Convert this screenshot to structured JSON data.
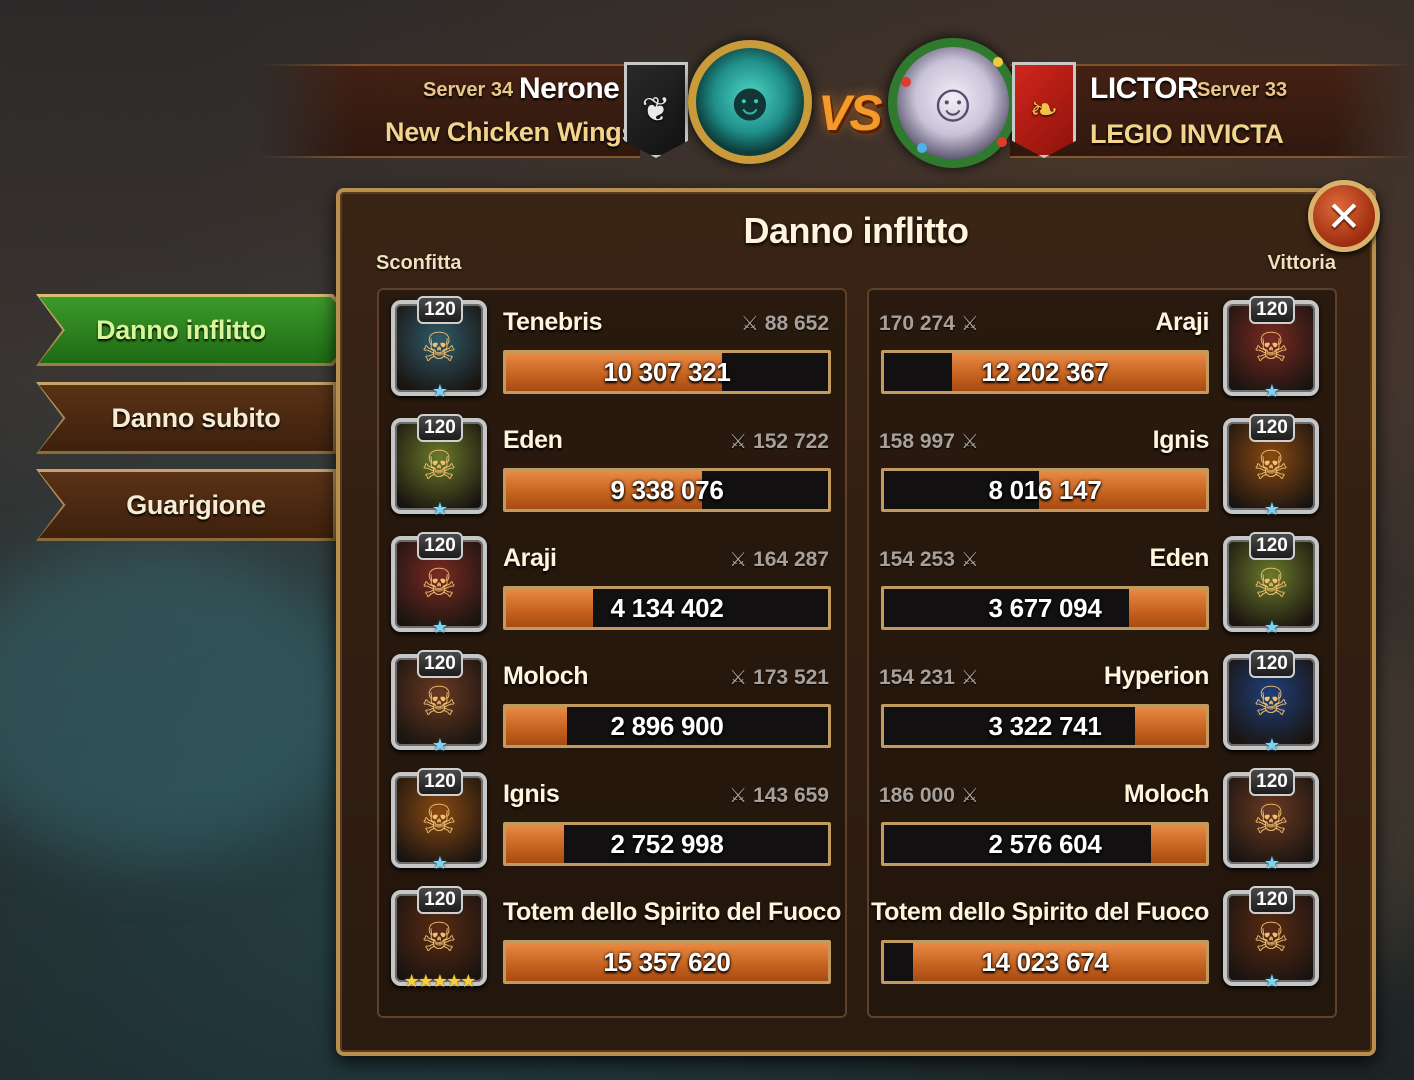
{
  "header": {
    "left_player": {
      "server": "Server 34",
      "name": "Nerone",
      "guild": "New Chicken Wings"
    },
    "right_player": {
      "server": "Server 33",
      "name": "LICTOR",
      "guild": "LEGIO INVICTA"
    },
    "vs_label": "VS"
  },
  "tabs": [
    {
      "label": "Danno inflitto",
      "active": true
    },
    {
      "label": "Danno subito",
      "active": false
    },
    {
      "label": "Guarigione",
      "active": false
    }
  ],
  "panel": {
    "title": "Danno inflitto",
    "left_label": "Sconfitta",
    "right_label": "Vittoria",
    "close_glyph": "✕"
  },
  "left_team": [
    {
      "name": "Tenebris",
      "level": "120",
      "power": "88 652",
      "damage": "10 307 321",
      "fill": 0.67,
      "portrait_icon": "tenebris-portrait",
      "color": "#2f5b6a",
      "stars": "★"
    },
    {
      "name": "Eden",
      "level": "120",
      "power": "152 722",
      "damage": "9 338 076",
      "fill": 0.61,
      "portrait_icon": "eden-portrait",
      "color": "#6a7a2a",
      "stars": "★"
    },
    {
      "name": "Araji",
      "level": "120",
      "power": "164 287",
      "damage": "4 134 402",
      "fill": 0.27,
      "portrait_icon": "araji-portrait",
      "color": "#7a2a22",
      "stars": "★"
    },
    {
      "name": "Moloch",
      "level": "120",
      "power": "173 521",
      "damage": "2 896 900",
      "fill": 0.19,
      "portrait_icon": "moloch-portrait",
      "color": "#6a3a22",
      "stars": "★"
    },
    {
      "name": "Ignis",
      "level": "120",
      "power": "143 659",
      "damage": "2 752 998",
      "fill": 0.18,
      "portrait_icon": "ignis-portrait",
      "color": "#8a4a12",
      "stars": "★"
    },
    {
      "name": "Totem dello Spirito del Fuoco",
      "level": "120",
      "power": "",
      "damage": "15 357 620",
      "fill": 1.0,
      "portrait_icon": "fire-totem-portrait",
      "color": "#5a2a14",
      "stars": "★★★★★"
    }
  ],
  "right_team": [
    {
      "name": "Araji",
      "level": "120",
      "power": "170 274",
      "damage": "12 202 367",
      "fill": 0.79,
      "portrait_icon": "araji-portrait",
      "color": "#7a2a22",
      "stars": "★"
    },
    {
      "name": "Ignis",
      "level": "120",
      "power": "158 997",
      "damage": "8 016 147",
      "fill": 0.52,
      "portrait_icon": "ignis-portrait",
      "color": "#8a4a12",
      "stars": "★"
    },
    {
      "name": "Eden",
      "level": "120",
      "power": "154 253",
      "damage": "3 677 094",
      "fill": 0.24,
      "portrait_icon": "eden-portrait",
      "color": "#6a7a2a",
      "stars": "★"
    },
    {
      "name": "Hyperion",
      "level": "120",
      "power": "154 231",
      "damage": "3 322 741",
      "fill": 0.22,
      "portrait_icon": "hyperion-portrait",
      "color": "#1f3f7a",
      "stars": "★"
    },
    {
      "name": "Moloch",
      "level": "120",
      "power": "186 000",
      "damage": "2 576 604",
      "fill": 0.17,
      "portrait_icon": "moloch-portrait",
      "color": "#6a3a22",
      "stars": "★"
    },
    {
      "name": "Totem dello Spirito del Fuoco",
      "level": "120",
      "power": "",
      "damage": "14 023 674",
      "fill": 0.91,
      "portrait_icon": "fire-totem-portrait",
      "color": "#5a2a14",
      "stars": "★"
    }
  ],
  "colors": {
    "bar_fill": "#d2702c",
    "tab_active": "#2f8a22",
    "accent_gold": "#c99b3a"
  }
}
